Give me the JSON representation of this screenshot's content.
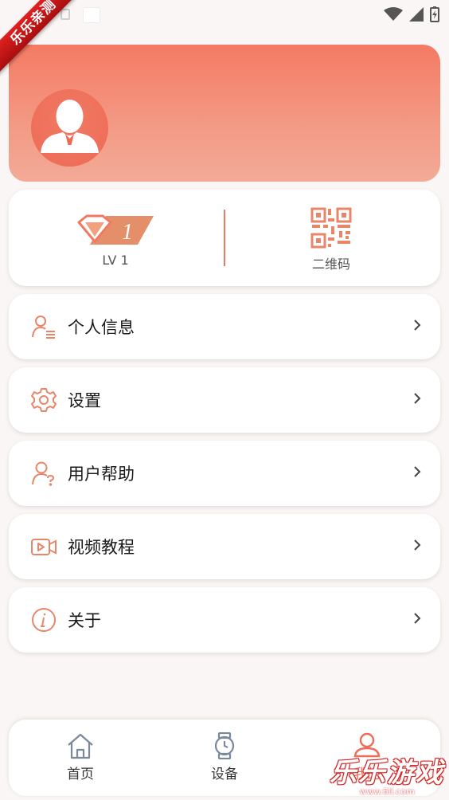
{
  "status_bar": {
    "icons": [
      "wifi-icon",
      "signal-icon",
      "battery-charging-icon"
    ]
  },
  "ribbon": {
    "text": "乐乐亲测"
  },
  "profile": {
    "avatar_icon": "user-avatar-icon"
  },
  "level": {
    "level_number": "1",
    "label": "LV 1",
    "qr_label": "二维码"
  },
  "menu": [
    {
      "label": "个人信息",
      "icon": "person-info-icon"
    },
    {
      "label": "设置",
      "icon": "gear-icon"
    },
    {
      "label": "用户帮助",
      "icon": "user-help-icon"
    },
    {
      "label": "视频教程",
      "icon": "video-play-icon"
    },
    {
      "label": "关于",
      "icon": "info-icon"
    }
  ],
  "bottom_nav": {
    "items": [
      {
        "label": "首页",
        "icon": "home-icon",
        "active": false
      },
      {
        "label": "设备",
        "icon": "watch-icon",
        "active": false
      },
      {
        "label": "我的",
        "icon": "person-icon",
        "active": true
      }
    ]
  },
  "watermark": {
    "text": "乐乐游戏",
    "url": "www.6ll.com"
  },
  "colors": {
    "accent": "#ef6d58",
    "header_top": "#f47a63",
    "header_bottom": "#f2ab97"
  }
}
